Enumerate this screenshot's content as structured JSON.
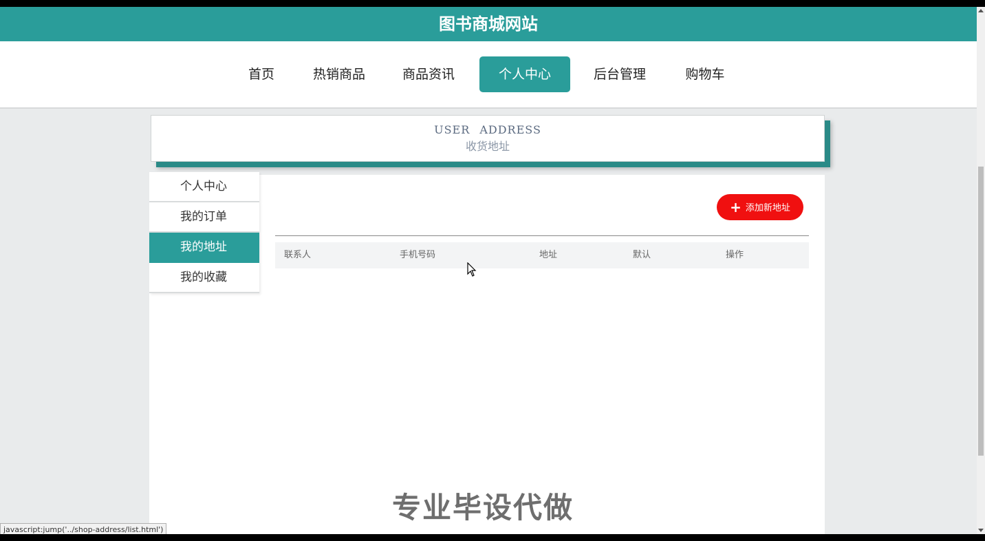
{
  "site": {
    "title": "图书商城网站"
  },
  "nav": {
    "items": [
      {
        "label": "首页"
      },
      {
        "label": "热销商品"
      },
      {
        "label": "商品资讯"
      },
      {
        "label": "个人中心"
      },
      {
        "label": "后台管理"
      },
      {
        "label": "购物车"
      }
    ],
    "active": "个人中心"
  },
  "section": {
    "title_en": "USER ADDRESS",
    "title_cn": "收货地址"
  },
  "sidebar": {
    "items": [
      {
        "label": "个人中心"
      },
      {
        "label": "我的订单"
      },
      {
        "label": "我的地址"
      },
      {
        "label": "我的收藏"
      }
    ],
    "active": "我的地址"
  },
  "actions": {
    "add_label": "添加新地址"
  },
  "table": {
    "headers": [
      "联系人",
      "手机号码",
      "地址",
      "默认",
      "操作"
    ]
  },
  "watermark": "专业毕设代做",
  "status_url": "javascript:jump('../shop-address/list.html')",
  "colors": {
    "brand": "#2a9d9a",
    "add_button": "#f01010"
  }
}
